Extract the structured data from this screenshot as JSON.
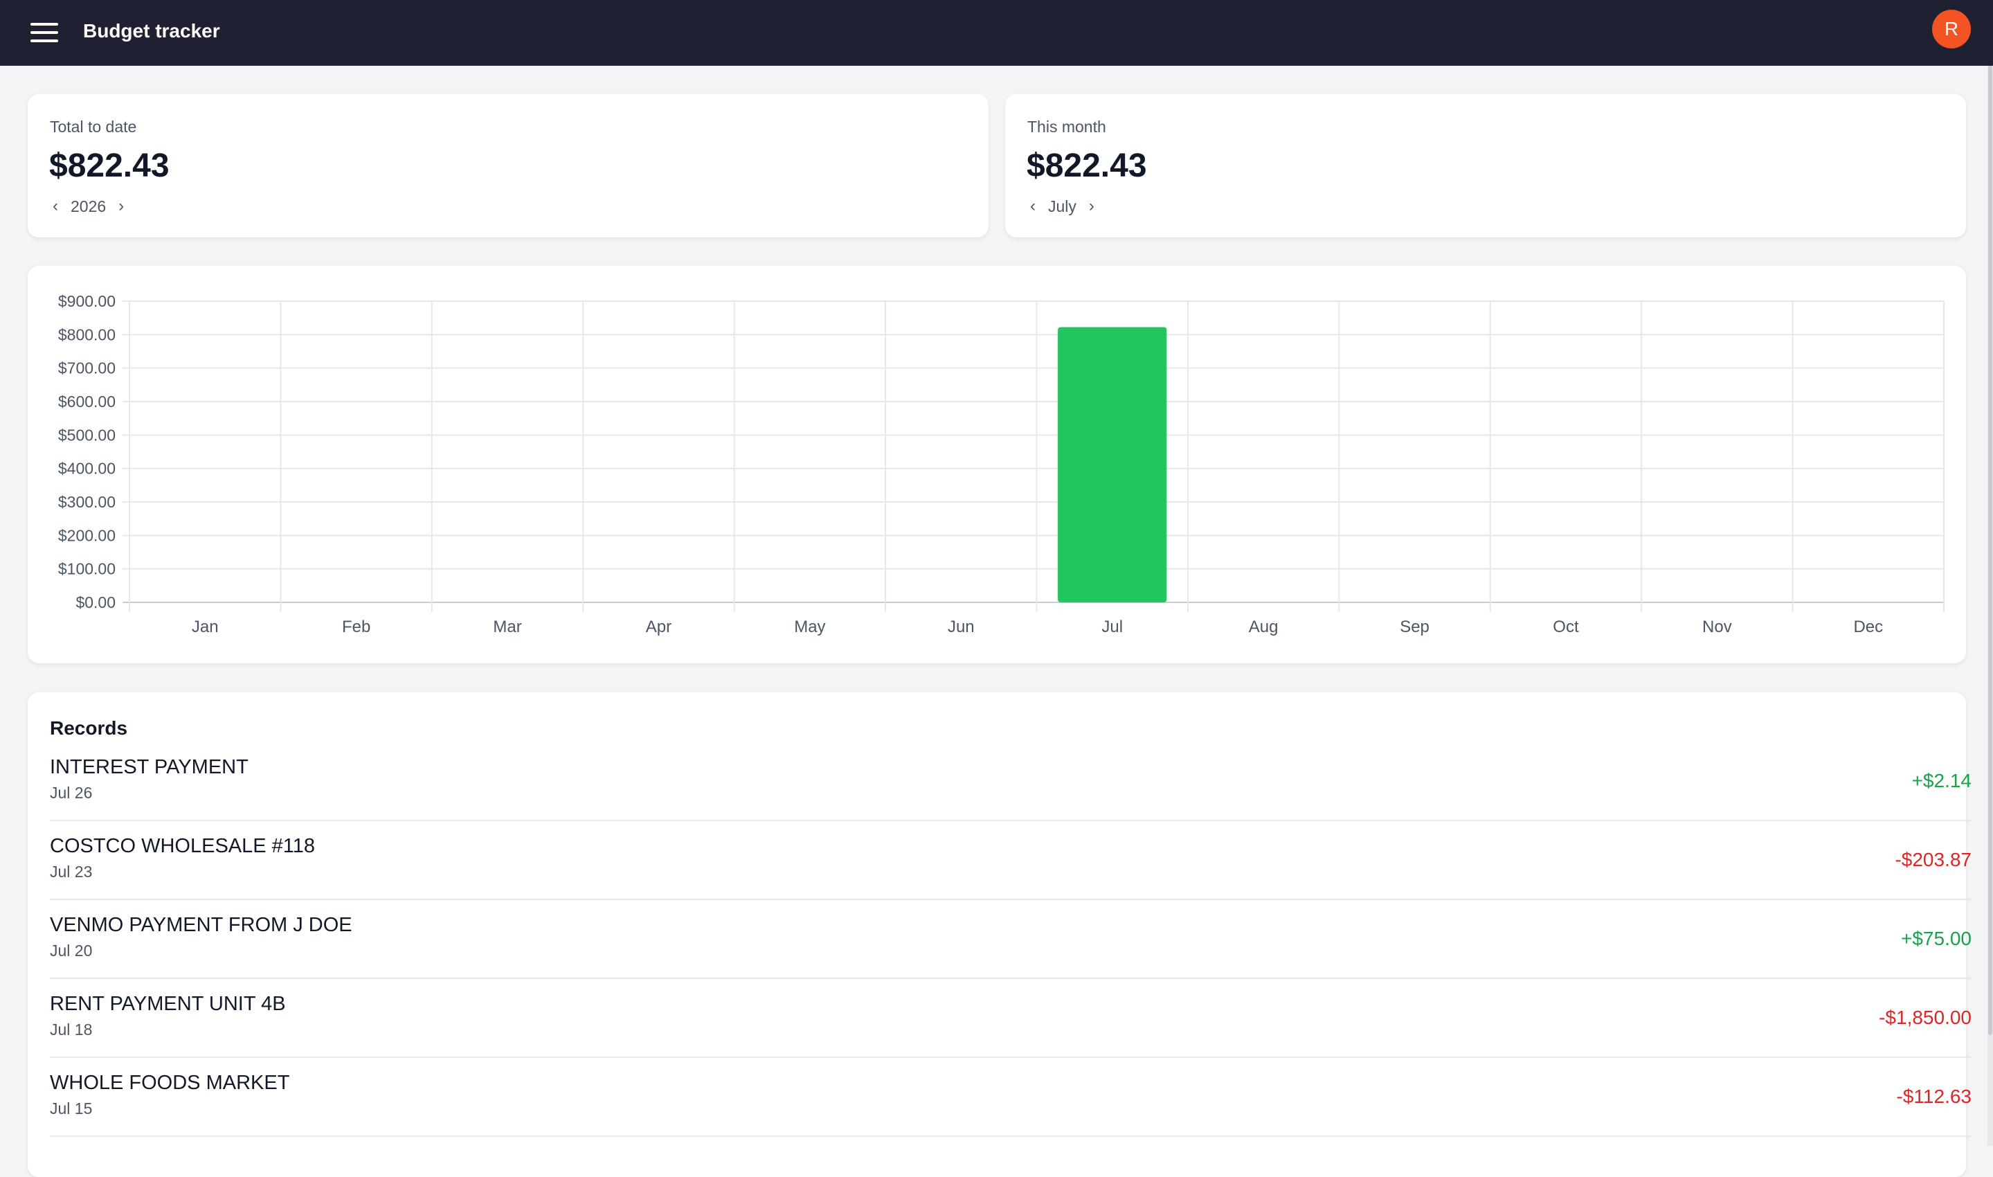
{
  "header": {
    "title": "Budget tracker",
    "avatar_initial": "R",
    "menu_icon": "hamburger-menu-icon"
  },
  "stats": {
    "total": {
      "label": "Total to date",
      "value": "$822.43",
      "period": "2026",
      "prev_symbol": "‹",
      "next_symbol": "›"
    },
    "month": {
      "label": "This month",
      "value": "$822.43",
      "period": "July",
      "prev_symbol": "‹",
      "next_symbol": "›"
    }
  },
  "chart_data": {
    "type": "bar",
    "categories": [
      "Jan",
      "Feb",
      "Mar",
      "Apr",
      "May",
      "Jun",
      "Jul",
      "Aug",
      "Sep",
      "Oct",
      "Nov",
      "Dec"
    ],
    "values": [
      0,
      0,
      0,
      0,
      0,
      0,
      822.43,
      0,
      0,
      0,
      0,
      0
    ],
    "ylim": [
      0,
      900
    ],
    "yticks": [
      "$0.00",
      "$100.00",
      "$200.00",
      "$300.00",
      "$400.00",
      "$500.00",
      "$600.00",
      "$700.00",
      "$800.00",
      "$900.00"
    ],
    "grid": true,
    "bar_color": "#22c55e",
    "title": "",
    "xlabel": "",
    "ylabel": ""
  },
  "records": {
    "title": "Records",
    "items": [
      {
        "name": "INTEREST PAYMENT",
        "date": "Jul 26",
        "amount": "+$2.14",
        "sign": "pos"
      },
      {
        "name": "COSTCO WHOLESALE #118",
        "date": "Jul 23",
        "amount": "-$203.87",
        "sign": "neg"
      },
      {
        "name": "VENMO PAYMENT FROM J DOE",
        "date": "Jul 20",
        "amount": "+$75.00",
        "sign": "pos"
      },
      {
        "name": "RENT PAYMENT UNIT 4B",
        "date": "Jul 18",
        "amount": "-$1,850.00",
        "sign": "neg"
      },
      {
        "name": "WHOLE FOODS MARKET",
        "date": "Jul 15",
        "amount": "-$112.63",
        "sign": "neg"
      }
    ]
  },
  "colors": {
    "topbar": "#1f2132",
    "avatar": "#f35422",
    "positive": "#16a34a",
    "negative": "#dc2626"
  }
}
